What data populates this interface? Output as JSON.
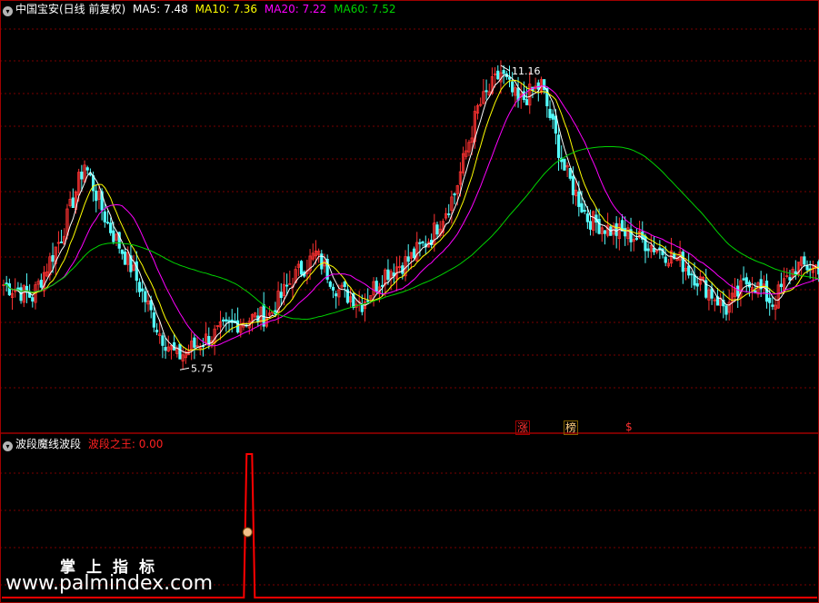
{
  "colors": {
    "up": "#ff3232",
    "down": "#54ffff",
    "ma5": "#ffffff",
    "ma10": "#ffff00",
    "ma20": "#ff00ff",
    "ma60": "#00d400",
    "grid": "#7a0000",
    "border": "#a00000",
    "indicator": "#ff0000"
  },
  "header": {
    "title": "中国宝安(日线 前复权)",
    "ma5": "MA5: 7.48",
    "ma10": "MA10: 7.36",
    "ma20": "MA20: 7.22",
    "ma60": "MA60: 7.52"
  },
  "indicator": {
    "title": "波段魔线波段",
    "label": "波段之王: 0.00"
  },
  "marks": {
    "zhang": "涨",
    "bang": "榜",
    "dollar": "$"
  },
  "watermark": {
    "cn": "掌上指标",
    "url": "www.palmindex.com"
  },
  "chart_data": {
    "type": "candlestick",
    "price_range": [
      5.0,
      11.6
    ],
    "high_label": "11.16",
    "low_label": "5.75",
    "anchors": [
      [
        0,
        7.2
      ],
      [
        10,
        7.0
      ],
      [
        20,
        8.0
      ],
      [
        28,
        9.2
      ],
      [
        36,
        8.2
      ],
      [
        44,
        7.5
      ],
      [
        54,
        6.4
      ],
      [
        60,
        6.0
      ],
      [
        70,
        6.3
      ],
      [
        82,
        6.6
      ],
      [
        92,
        6.7
      ],
      [
        100,
        7.3
      ],
      [
        108,
        7.7
      ],
      [
        116,
        7.1
      ],
      [
        124,
        6.9
      ],
      [
        132,
        7.4
      ],
      [
        140,
        7.6
      ],
      [
        148,
        8.0
      ],
      [
        156,
        8.7
      ],
      [
        164,
        10.1
      ],
      [
        172,
        10.7
      ],
      [
        178,
        10.2
      ],
      [
        186,
        10.5
      ],
      [
        194,
        9.1
      ],
      [
        202,
        8.3
      ],
      [
        210,
        8.1
      ],
      [
        218,
        8.0
      ],
      [
        226,
        7.8
      ],
      [
        234,
        7.6
      ],
      [
        242,
        7.2
      ],
      [
        250,
        6.8
      ],
      [
        258,
        7.3
      ],
      [
        266,
        6.9
      ],
      [
        274,
        7.5
      ],
      [
        282,
        7.5
      ]
    ],
    "indicator": {
      "values_desc": "flat at 0 except a single spike",
      "spike_index": 85,
      "spike_value": 1.0
    }
  }
}
